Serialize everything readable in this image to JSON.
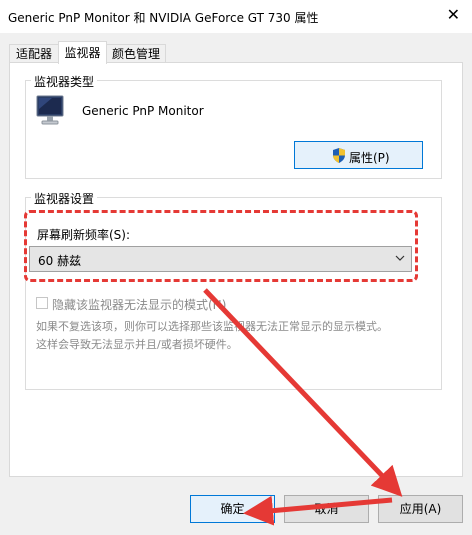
{
  "window": {
    "title": "Generic PnP Monitor 和 NVIDIA GeForce GT 730 属性",
    "close_glyph": "✕"
  },
  "tabs": [
    {
      "label": "适配器"
    },
    {
      "label": "监视器"
    },
    {
      "label": "颜色管理"
    }
  ],
  "monitor_type": {
    "group_label": "监视器类型",
    "monitor_name": "Generic PnP Monitor",
    "monitor_icon": "monitor-icon",
    "properties_label": "属性(P)",
    "shield_icon": "shield-icon"
  },
  "monitor_settings": {
    "group_label": "监视器设置",
    "refresh_label": "屏幕刷新频率(S):",
    "refresh_value": "60 赫兹",
    "hide_modes_label": "隐藏该监视器无法显示的模式(H)",
    "hide_modes_checked": false,
    "description_line1": "如果不复选该项，则你可以选择那些该监视器无法正常显示的显示模式。",
    "description_line2": "这样会导致无法显示并且/或者损坏硬件。"
  },
  "footer": {
    "ok_label": "确定",
    "cancel_label": "取消",
    "apply_label": "应用(A)"
  },
  "annotation": {
    "color": "#e53935"
  }
}
